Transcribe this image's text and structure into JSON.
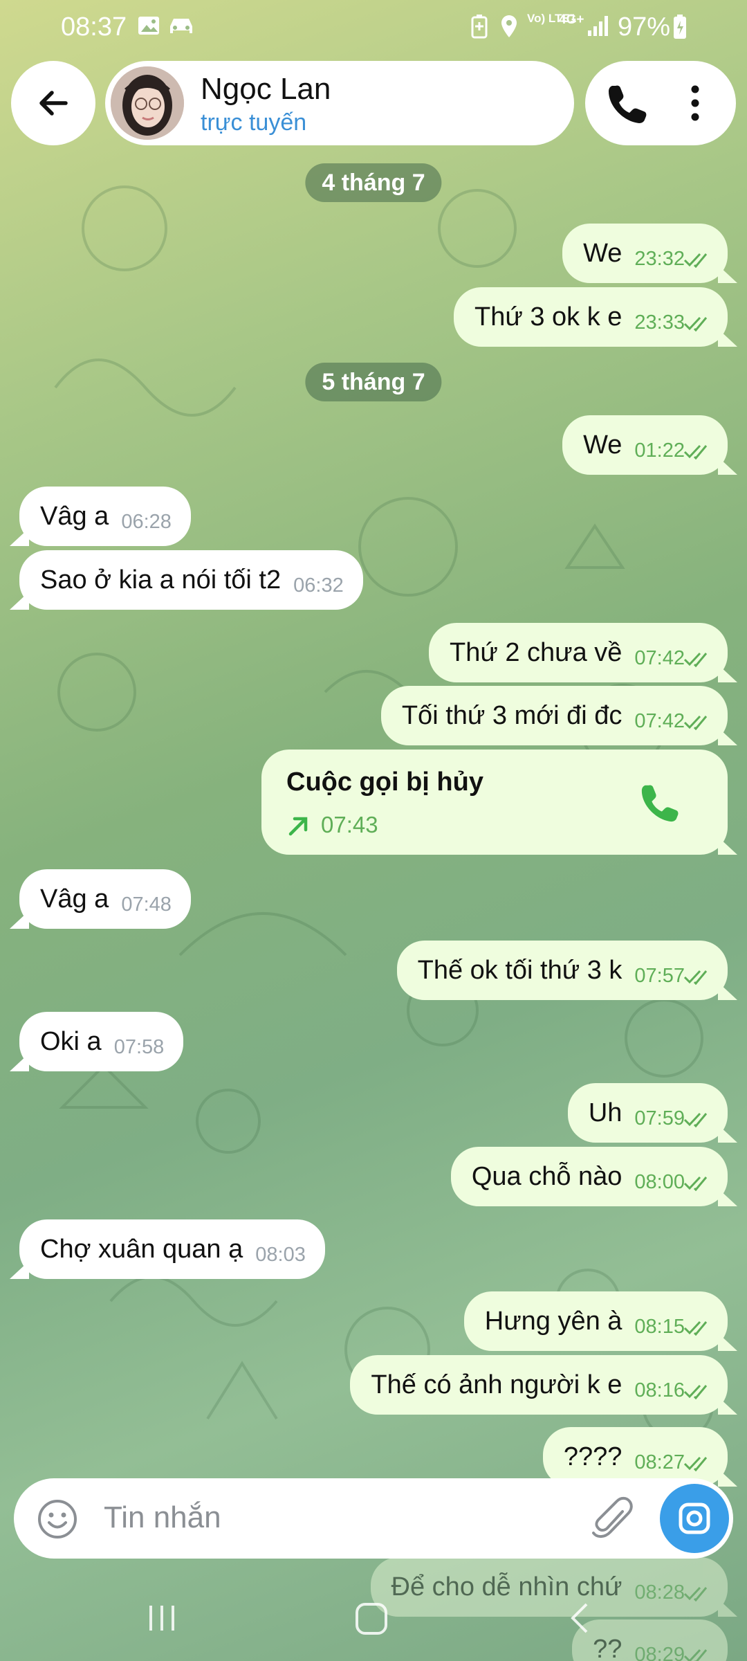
{
  "status_bar": {
    "time": "08:37",
    "battery_percent": "97%",
    "icons": [
      "gallery-icon",
      "car-icon",
      "battery-saver-icon",
      "location-icon",
      "volte-icon",
      "4g-icon",
      "signal-icon",
      "battery-charging-icon"
    ],
    "volte_label": "Vo) LTE1",
    "network_label": "4G+"
  },
  "header": {
    "contact_name": "Ngọc Lan",
    "contact_status": "trực tuyến",
    "icons": {
      "back": "arrow-left-icon",
      "call": "phone-icon",
      "more": "more-vertical-icon"
    }
  },
  "conversation": {
    "date_chips": [
      "4 tháng 7",
      "5 tháng 7"
    ],
    "messages": [
      {
        "dir": "out",
        "text": "We",
        "time": "23:32",
        "read": true
      },
      {
        "dir": "out",
        "text": "Thứ 3 ok k e",
        "time": "23:33",
        "read": true
      },
      {
        "dir": "out",
        "text": "We",
        "time": "01:22",
        "read": true
      },
      {
        "dir": "in",
        "text": "Vâg a",
        "time": "06:28"
      },
      {
        "dir": "in",
        "text": "Sao ở kia a nói tối t2",
        "time": "06:32"
      },
      {
        "dir": "out",
        "text": "Thứ 2 chưa về",
        "time": "07:42",
        "read": true
      },
      {
        "dir": "out",
        "text": "Tối thứ 3 mới đi đc",
        "time": "07:42",
        "read": true
      },
      {
        "dir": "in",
        "text": "Vâg a",
        "time": "07:48"
      },
      {
        "dir": "out",
        "text": "Thế ok tối thứ 3 k",
        "time": "07:57",
        "read": true
      },
      {
        "dir": "in",
        "text": "Oki a",
        "time": "07:58"
      },
      {
        "dir": "out",
        "text": "Uh",
        "time": "07:59",
        "read": true
      },
      {
        "dir": "out",
        "text": "Qua chỗ nào",
        "time": "08:00",
        "read": true
      },
      {
        "dir": "in",
        "text": "Chợ xuân quan ạ",
        "time": "08:03"
      },
      {
        "dir": "out",
        "text": "Hưng yên à",
        "time": "08:15",
        "read": true
      },
      {
        "dir": "out",
        "text": "Thế có ảnh người k e",
        "time": "08:16",
        "read": true
      },
      {
        "dir": "out",
        "text": "????",
        "time": "08:27",
        "read": true
      },
      {
        "dir": "out",
        "text": "Để cho dễ nhìn chứ",
        "time": "08:28",
        "read": true
      },
      {
        "dir": "out",
        "text": "??",
        "time": "08:29",
        "read": true
      }
    ],
    "call_card": {
      "title": "Cuộc gọi bị hủy",
      "time": "07:43",
      "icons": {
        "direction": "outgoing-arrow-icon",
        "call": "phone-icon"
      }
    }
  },
  "composer": {
    "placeholder": "Tin nhắn",
    "icons": {
      "emoji": "emoji-icon",
      "attach": "paperclip-icon",
      "camera": "camera-icon"
    }
  },
  "navigation_bar": {
    "icons": [
      "recent-apps-icon",
      "home-icon",
      "back-icon"
    ]
  },
  "colors": {
    "outgoing_bubble": "#effdde",
    "incoming_bubble": "#ffffff",
    "outgoing_time": "#5fae57",
    "status_online": "#3a8fd6",
    "camera_button": "#3a9ee8"
  }
}
